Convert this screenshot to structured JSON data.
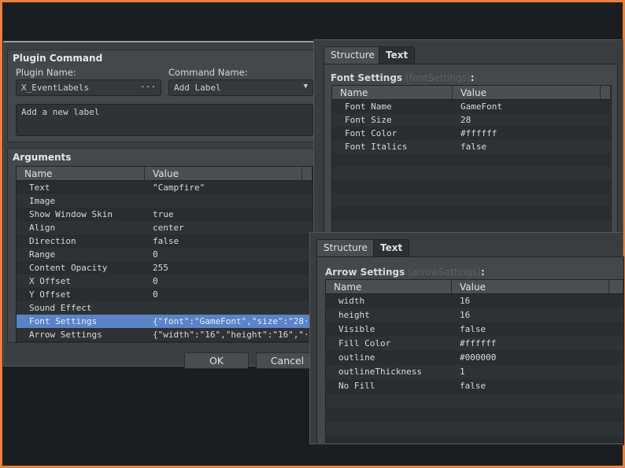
{
  "plugin_command": {
    "title": "Plugin Command",
    "plugin_name_label": "Plugin Name:",
    "plugin_name_value": "X_EventLabels",
    "plugin_name_button": "···",
    "command_name_label": "Command Name:",
    "command_name_value": "Add Label",
    "description": "Add a new label"
  },
  "arguments": {
    "title": "Arguments",
    "columns": [
      "Name",
      "Value"
    ],
    "rows": [
      {
        "name": "Text",
        "value": "\"Campfire\""
      },
      {
        "name": "Image",
        "value": ""
      },
      {
        "name": "Show Window Skin",
        "value": "true"
      },
      {
        "name": "Align",
        "value": "center"
      },
      {
        "name": "Direction",
        "value": "false"
      },
      {
        "name": "Range",
        "value": "0"
      },
      {
        "name": "Content Opacity",
        "value": "255"
      },
      {
        "name": "X Offset",
        "value": "0"
      },
      {
        "name": "Y Offset",
        "value": "0"
      },
      {
        "name": "Sound Effect",
        "value": ""
      },
      {
        "name": "Font Settings",
        "value": "{\"font\":\"GameFont\",\"size\":\"28···"
      },
      {
        "name": "Arrow Settings",
        "value": "{\"width\":\"16\",\"height\":\"16\",\"···"
      }
    ]
  },
  "buttons": {
    "ok": "OK",
    "cancel": "Cancel"
  },
  "font_window": {
    "tabs": [
      "Structure",
      "Text"
    ],
    "title": "Font Settings",
    "key": "(fontSettings)",
    "colon": ":",
    "columns": [
      "Name",
      "Value"
    ],
    "rows": [
      {
        "name": "Font Name",
        "value": "GameFont"
      },
      {
        "name": "Font Size",
        "value": "28"
      },
      {
        "name": "Font Color",
        "value": "#ffffff"
      },
      {
        "name": "Font Italics",
        "value": "false"
      }
    ]
  },
  "arrow_window": {
    "tabs": [
      "Structure",
      "Text"
    ],
    "title": "Arrow Settings",
    "key": "(arrowSettings)",
    "colon": ":",
    "columns": [
      "Name",
      "Value"
    ],
    "rows": [
      {
        "name": "width",
        "value": "16"
      },
      {
        "name": "height",
        "value": "16"
      },
      {
        "name": "Visible",
        "value": "false"
      },
      {
        "name": "Fill Color",
        "value": "#ffffff"
      },
      {
        "name": "outline",
        "value": "#000000"
      },
      {
        "name": "outlineThickness",
        "value": "1"
      },
      {
        "name": "No Fill",
        "value": "false"
      }
    ]
  },
  "colors": {
    "accent": "#e8813a",
    "selection": "#5a83c8"
  }
}
